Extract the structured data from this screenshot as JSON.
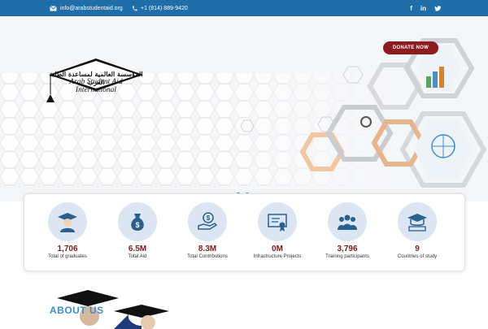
{
  "topbar": {
    "email": "info@arabstudentaid.org",
    "phone": "+1 (814) 889-9420",
    "social": [
      "facebook-icon",
      "linkedin-icon",
      "twitter-icon"
    ]
  },
  "logo": {
    "arabic": "المؤسسة العالمية لمساعدة الطلبة العرب",
    "english": "Arab Student Aid International"
  },
  "donate_label": "DONATE NOW",
  "slider": {
    "slides": 2,
    "active": 0
  },
  "stats": [
    {
      "icon": "graduate-icon",
      "value": "1,706",
      "label": "Total of graduates"
    },
    {
      "icon": "money-bag-icon",
      "value": "6.5M",
      "label": "Total Aid"
    },
    {
      "icon": "hand-dollar-icon",
      "value": "8.3M",
      "label": "Total Contributions"
    },
    {
      "icon": "certificate-icon",
      "value": "0M",
      "label": "Infrastructure Projects"
    },
    {
      "icon": "group-icon",
      "value": "3,796",
      "label": "Training participants"
    },
    {
      "icon": "study-icon",
      "value": "9",
      "label": "Countries of study"
    }
  ],
  "about_heading": "ABOUT US",
  "colors": {
    "topbar": "#1f6ea9",
    "accent": "#3a8fcf",
    "stat_value": "#7a1a1a",
    "donate": "#8e1c1f"
  }
}
